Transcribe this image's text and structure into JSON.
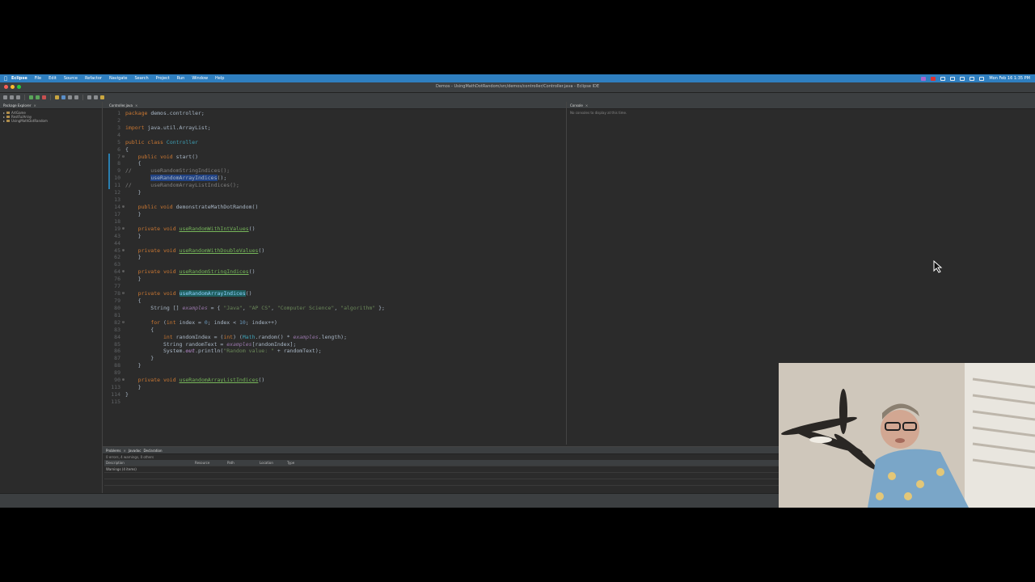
{
  "menubar": {
    "app": "Eclipse",
    "items": [
      "File",
      "Edit",
      "Source",
      "Refactor",
      "Navigate",
      "Search",
      "Project",
      "Run",
      "Window",
      "Help"
    ],
    "clock": "Mon Feb 16  1:35 PM"
  },
  "window": {
    "title": "Demos - UsingMathDotRandom/src/demos/controller/Controller.java - Eclipse IDE"
  },
  "package_explorer": {
    "tab_label": "Package Explorer",
    "projects": [
      "ArtGame",
      "RestFulArray",
      "UsingMathDotRandom"
    ]
  },
  "editor": {
    "tab_label": "Controller.java",
    "lines": [
      {
        "n": "1",
        "f": "",
        "t": "package demos.controller;"
      },
      {
        "n": "2",
        "f": "",
        "t": ""
      },
      {
        "n": "3",
        "f": "",
        "t": "import java.util.ArrayList;"
      },
      {
        "n": "4",
        "f": "",
        "t": ""
      },
      {
        "n": "5",
        "f": "",
        "t": "public class Controller"
      },
      {
        "n": "6",
        "f": "",
        "t": "{"
      },
      {
        "n": "7",
        "f": "⊖",
        "t": "    public void start()"
      },
      {
        "n": "8",
        "f": "",
        "t": "    {"
      },
      {
        "n": "9",
        "f": "",
        "t": "//      useRandomStringIndices();"
      },
      {
        "n": "10",
        "f": "",
        "t": "        useRandomArrayIndices();"
      },
      {
        "n": "11",
        "f": "",
        "t": "//      useRandomArrayListIndices();"
      },
      {
        "n": "12",
        "f": "",
        "t": "    }"
      },
      {
        "n": "13",
        "f": "",
        "t": ""
      },
      {
        "n": "14",
        "f": "⊕",
        "t": "    public void demonstrateMathDotRandom()"
      },
      {
        "n": "17",
        "f": "",
        "t": "    }"
      },
      {
        "n": "18",
        "f": "",
        "t": ""
      },
      {
        "n": "19",
        "f": "⊕",
        "t": "    private void useRandomWithIntValues()"
      },
      {
        "n": "43",
        "f": "",
        "t": "    }"
      },
      {
        "n": "44",
        "f": "",
        "t": ""
      },
      {
        "n": "45",
        "f": "⊕",
        "t": "    private void useRandomWithDoubleValues()"
      },
      {
        "n": "62",
        "f": "",
        "t": "    }"
      },
      {
        "n": "63",
        "f": "",
        "t": ""
      },
      {
        "n": "64",
        "f": "⊕",
        "t": "    private void useRandomStringIndices()"
      },
      {
        "n": "76",
        "f": "",
        "t": "    }"
      },
      {
        "n": "77",
        "f": "",
        "t": ""
      },
      {
        "n": "78",
        "f": "⊖",
        "t": "    private void useRandomArrayIndices()"
      },
      {
        "n": "79",
        "f": "",
        "t": "    {"
      },
      {
        "n": "80",
        "f": "",
        "t": "        String [] examples = { \"Java\", \"AP CS\", \"Computer Science\", \"algorithm\" };"
      },
      {
        "n": "81",
        "f": "",
        "t": ""
      },
      {
        "n": "82",
        "f": "⊖",
        "t": "        for (int index = 0; index < 10; index++)"
      },
      {
        "n": "83",
        "f": "",
        "t": "        {"
      },
      {
        "n": "84",
        "f": "",
        "t": "            int randomIndex = (int) (Math.random() * examples.length);"
      },
      {
        "n": "85",
        "f": "",
        "t": "            String randomText = examples[randomIndex];"
      },
      {
        "n": "86",
        "f": "",
        "t": "            System.out.println(\"Random value: \" + randomText);"
      },
      {
        "n": "87",
        "f": "",
        "t": "        }"
      },
      {
        "n": "88",
        "f": "",
        "t": "    }"
      },
      {
        "n": "89",
        "f": "",
        "t": ""
      },
      {
        "n": "90",
        "f": "⊕",
        "t": "    private void useRandomArrayListIndices()"
      },
      {
        "n": "113",
        "f": "",
        "t": "    }"
      },
      {
        "n": "114",
        "f": "",
        "t": "}"
      },
      {
        "n": "115",
        "f": "",
        "t": ""
      }
    ]
  },
  "console": {
    "tab_label": "Console",
    "message": "No consoles to display at this time."
  },
  "problems": {
    "tabs": [
      "Problems",
      "Javadoc",
      "Declaration"
    ],
    "summary": "0 errors, 4 warnings, 0 others",
    "columns": [
      "Description",
      "Resource",
      "Path",
      "Location",
      "Type"
    ],
    "rows": [
      [
        "Warnings (4 items)",
        "",
        "",
        "",
        ""
      ]
    ]
  },
  "colors": {
    "menubar": "#2f7fc0",
    "editor_bg": "#2b2b2b",
    "keyword": "#cc7832",
    "string": "#6a8759",
    "method_link": "#76b65a"
  }
}
